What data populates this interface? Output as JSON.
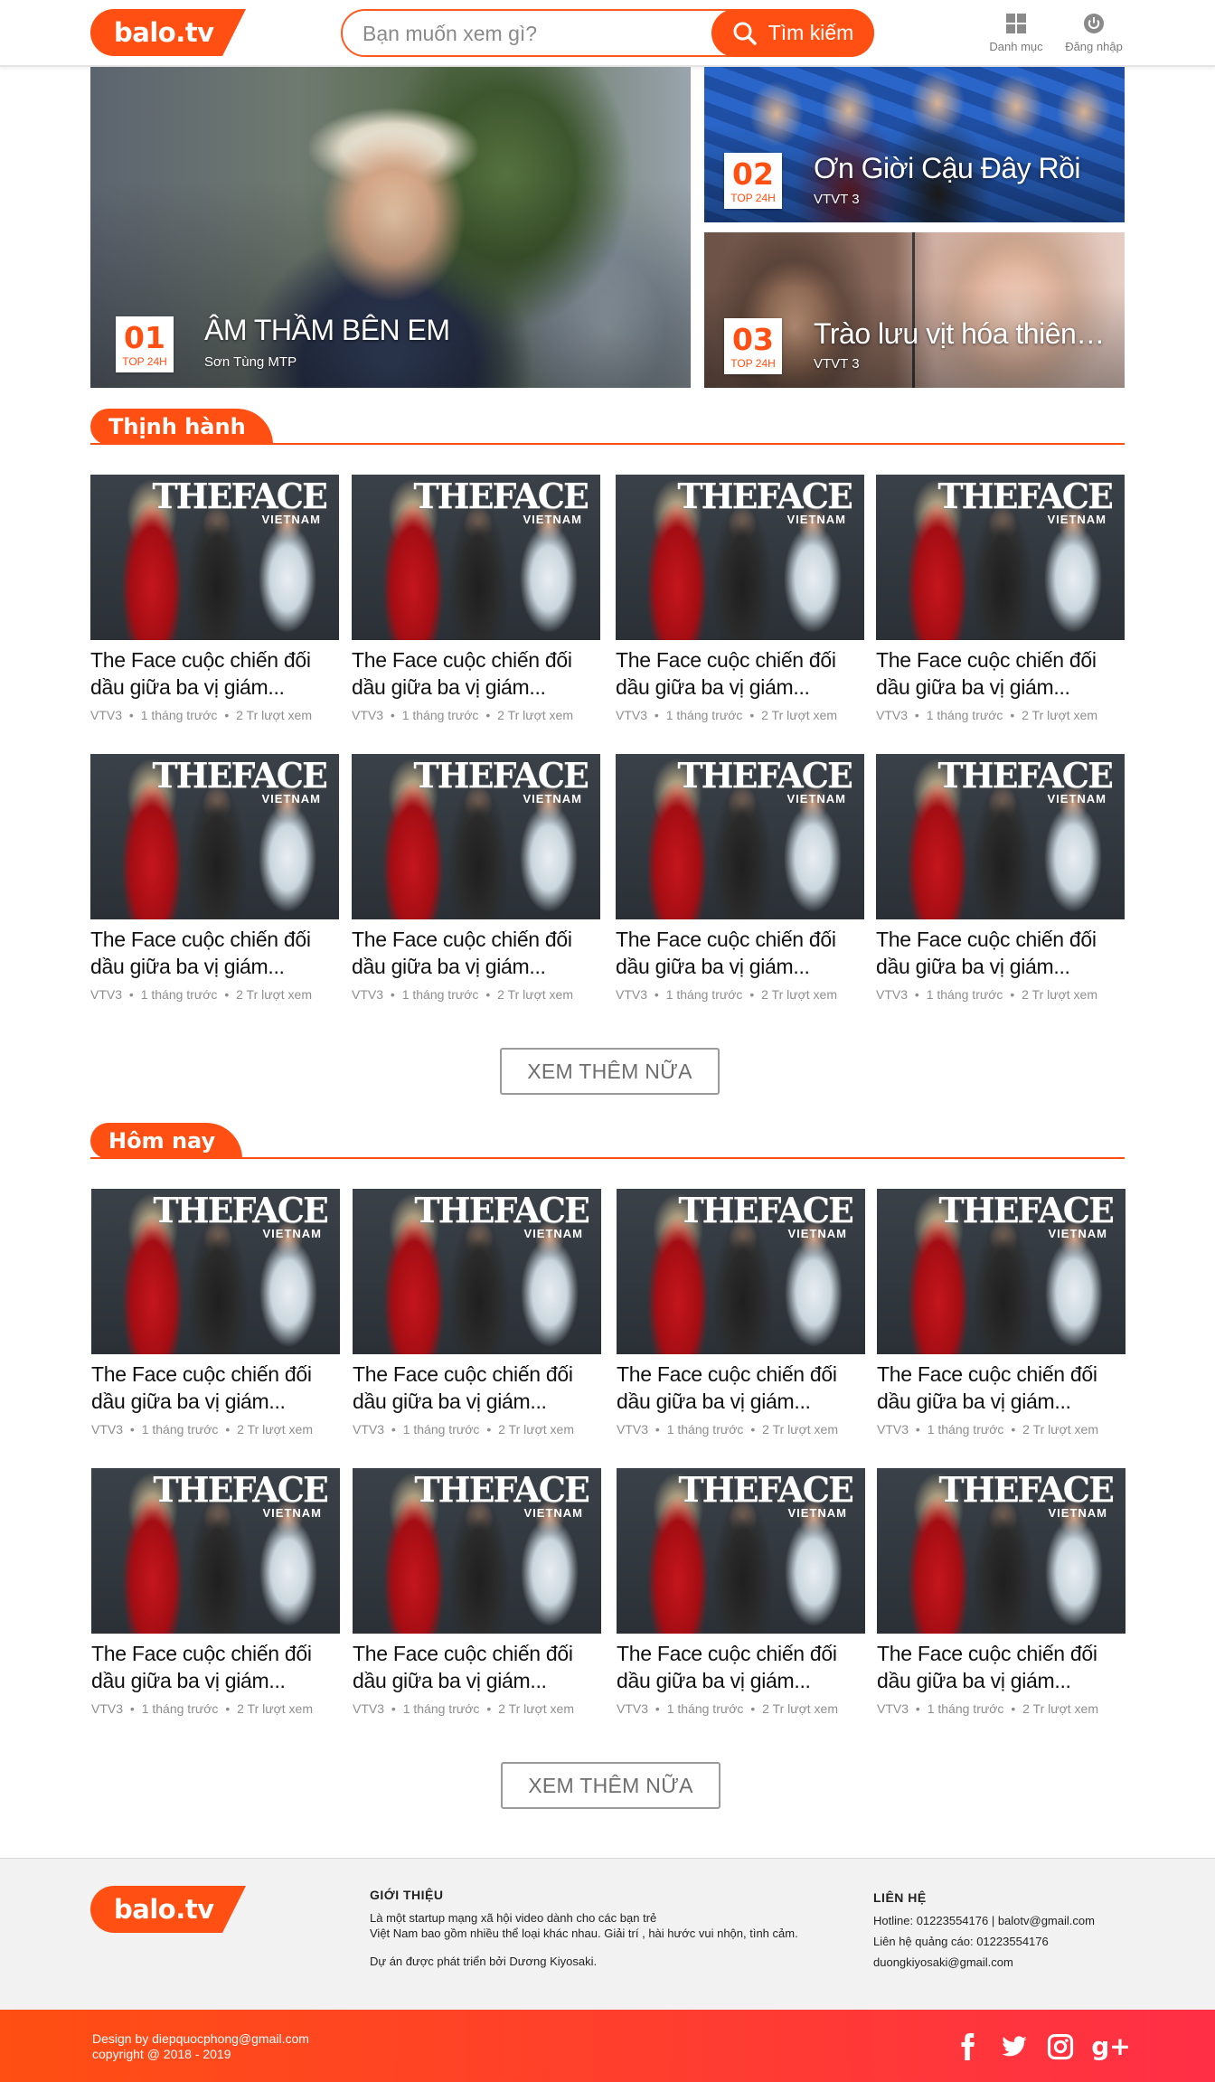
{
  "brand": {
    "logo_text": "balo.tv",
    "accent": "#ff4f12"
  },
  "header": {
    "search_placeholder": "Bạn muốn xem gì?",
    "search_button": "Tìm kiếm",
    "menu_label": "Danh mục",
    "login_label": "Đăng nhập"
  },
  "hero": [
    {
      "rank": "01",
      "tag": "TOP 24H",
      "title": "ÂM THẦM BÊN EM",
      "subtitle": "Sơn Tùng MTP"
    },
    {
      "rank": "02",
      "tag": "TOP 24H",
      "title": "Ơn Giời Cậu Đây Rồi",
      "subtitle": "VTVT 3"
    },
    {
      "rank": "03",
      "tag": "TOP 24H",
      "title": "Trào lưu vịt hóa thiên nga",
      "subtitle": "VTVT 3"
    }
  ],
  "video": {
    "thumb_mark": "THEFACE",
    "thumb_mark_sub": "VIETNAM",
    "title_line1": "The Face cuộc chiến đối",
    "title_line2": "dầu giữa ba vị giám...",
    "channel": "VTV3",
    "time": "1 tháng trước",
    "views": "2 Tr lượt xem",
    "sep": "•"
  },
  "sections": [
    {
      "title": "Thịnh hành",
      "more_label": "XEM THÊM NỮA"
    },
    {
      "title": "Hôm nay",
      "more_label": "XEM THÊM NỮA"
    }
  ],
  "footer": {
    "about_heading": "GIỚI THIỆU",
    "about_line1": "Là một startup mạng xã hội video dành cho các bạn trẻ",
    "about_line2": "Việt Nam bao gồm nhiều thể loại khác nhau. Giải trí , hài hước vui nhộn, tình cảm.",
    "about_line3": "Dự án được phát triển bởi Dương Kiyosaki.",
    "contact_heading": "LIÊN HỆ",
    "contact_line1": "Hotline: 01223554176 | balotv@gmail.com",
    "contact_line2": "Liên hệ quảng cáo: 01223554176",
    "contact_line3": "duongkiyosaki@gmail.com",
    "design_credit": "Design by diepquocphong@gmail.com",
    "copyright": "copyright @ 2018 - 2019",
    "social": [
      "facebook-icon",
      "twitter-icon",
      "instagram-icon",
      "google-plus-icon"
    ],
    "google_plus_glyph": "g+"
  }
}
